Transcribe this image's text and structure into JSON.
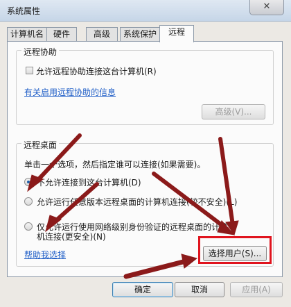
{
  "window": {
    "title": "系统属性",
    "close_glyph": "✕"
  },
  "tabs": [
    {
      "label": "计算机名",
      "active": false
    },
    {
      "label": "硬件",
      "active": false
    },
    {
      "label": "高级",
      "active": false
    },
    {
      "label": "系统保护",
      "active": false
    },
    {
      "label": "远程",
      "active": true
    }
  ],
  "remote_assistance": {
    "group_label": "远程协助",
    "allow_checkbox_label": "允许远程协助连接这台计算机(R)",
    "allow_checked": false,
    "info_link": "有关启用远程协助的信息",
    "advanced_button": "高级(V)..."
  },
  "remote_desktop": {
    "group_label": "远程桌面",
    "instruction": "单击一个选项，然后指定谁可以连接(如果需要)。",
    "option_no_connect": "不允许连接到这台计算机(D)",
    "option_any_version": "允许运行任意版本远程桌面的计算机连接(较不安全)(L)",
    "option_nla_line1": "仅允许运行使用网络级别身份验证的远程桌面的计算",
    "option_nla_line2": "机连接(更安全)(N)",
    "selected_option": "option_no_connect",
    "help_link": "帮助我选择",
    "select_users_button": "选择用户(S)..."
  },
  "footer": {
    "ok_button": "确定",
    "cancel_button": "取消",
    "apply_button": "应用(A)"
  },
  "colors": {
    "annotation_arrow": "#8b1a1a",
    "highlight_box": "#e0141e",
    "link": "#1f5ec7"
  }
}
